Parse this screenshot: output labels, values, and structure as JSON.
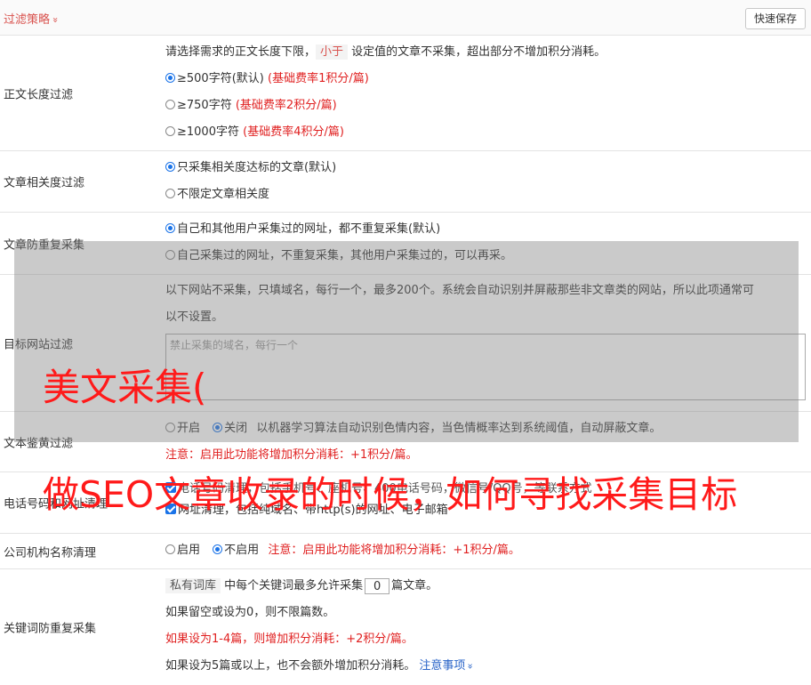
{
  "header": {
    "title": "过滤策略",
    "chevron": "»",
    "save_label": "快速保存"
  },
  "body_length": {
    "label": "正文长度过滤",
    "desc_prefix": "请选择需求的正文长度下限，",
    "desc_highlight": "小于",
    "desc_suffix": "设定值的文章不采集，超出部分不增加积分消耗。",
    "options": [
      {
        "text": "≥500字符(默认)",
        "note": "(基础费率1积分/篇)",
        "selected": true
      },
      {
        "text": "≥750字符",
        "note": "(基础费率2积分/篇)",
        "selected": false
      },
      {
        "text": "≥1000字符",
        "note": "(基础费率4积分/篇)",
        "selected": false
      }
    ]
  },
  "relevance": {
    "label": "文章相关度过滤",
    "options": [
      {
        "text": "只采集相关度达标的文章(默认)",
        "selected": true
      },
      {
        "text": "不限定文章相关度",
        "selected": false
      }
    ]
  },
  "dedupe": {
    "label": "文章防重复采集",
    "options": [
      {
        "text": "自己和其他用户采集过的网址，都不重复采集(默认)",
        "selected": true
      },
      {
        "text": "自己采集过的网址，不重复采集，其他用户采集过的，可以再采。",
        "selected": false
      }
    ]
  },
  "target_sites": {
    "label": "目标网站过滤",
    "desc_line1": "以下网站不采集，只填域名，每行一个，最多200个。系统会自动识别并屏蔽那些非文章类的网站，所以此项通常可",
    "desc_line2": "以不设置。",
    "placeholder": "禁止采集的域名，每行一个"
  },
  "porn_filter": {
    "label": "文本鉴黄过滤",
    "opt_on": "开启",
    "opt_off": "关闭",
    "desc": "以机器学习算法自动识别色情内容，当色情概率达到系统阈值，自动屏蔽文章。",
    "notice": "注意：启用此功能将增加积分消耗：+1积分/篇。"
  },
  "contact_clean": {
    "label": "电话号码和网址清理",
    "line1": "电话号码清理，包括手机号、座机号、400电话号码，微信号/QQ号，等联系方式",
    "line2": "网址清理，包括纯域名、带http(s)的网址、电子邮箱"
  },
  "company_clean": {
    "label": "公司机构名称清理",
    "opt_on": "启用",
    "opt_off": "不启用",
    "notice": "注意：启用此功能将增加积分消耗：+1积分/篇。"
  },
  "keyword_dedupe": {
    "label": "关键词防重复采集",
    "tag": "私有词库",
    "prefix": "中每个关键词最多允许采集",
    "value": "0",
    "suffix": "篇文章。",
    "line2": "如果留空或设为0，则不限篇数。",
    "line3": "如果设为1-4篇，则增加积分消耗：+2积分/篇。",
    "line4": "如果设为5篇或以上，也不会额外增加积分消耗。",
    "link": "注意事项",
    "link_chevron": "»"
  },
  "watermark": {
    "line1": "美文采集(",
    "line2": "做SEO文章收录的时候，如何寻找采集目标"
  },
  "colors": {
    "accent_red": "#e02020",
    "radio_blue": "#1a73e8",
    "link_blue": "#2a64c8",
    "watermark_red": "#ff1a1a"
  }
}
